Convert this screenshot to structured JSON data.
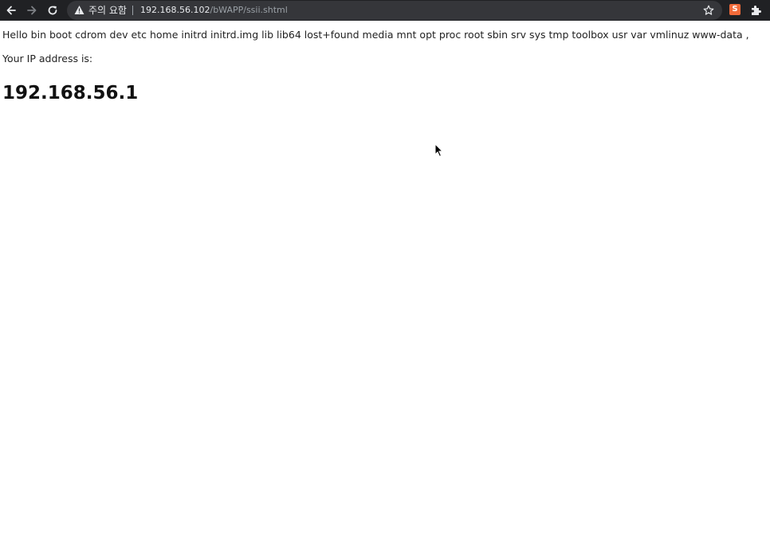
{
  "browser": {
    "security_label": "주의 요함",
    "url_host": "192.168.56.102",
    "url_path": "/bWAPP/ssii.shtml",
    "colors": {
      "toolbar": "#202124",
      "omnibox": "#35363a",
      "extension": "#f26b3a"
    },
    "icons": {
      "back": "arrow-left-icon",
      "forward": "arrow-right-icon",
      "reload": "reload-icon",
      "warning": "warning-triangle-icon",
      "bookmark": "star-icon",
      "extension": "extension-s-icon",
      "extensions_menu": "puzzle-icon"
    },
    "extension_glyph": "S"
  },
  "page": {
    "hello_text": "Hello bin boot cdrom dev etc home initrd initrd.img lib lib64 lost+found media mnt opt proc root sbin srv sys tmp toolbox usr var vmlinuz www-data ,",
    "ip_label": "Your IP address is:",
    "ip_value": "192.168.56.1"
  }
}
